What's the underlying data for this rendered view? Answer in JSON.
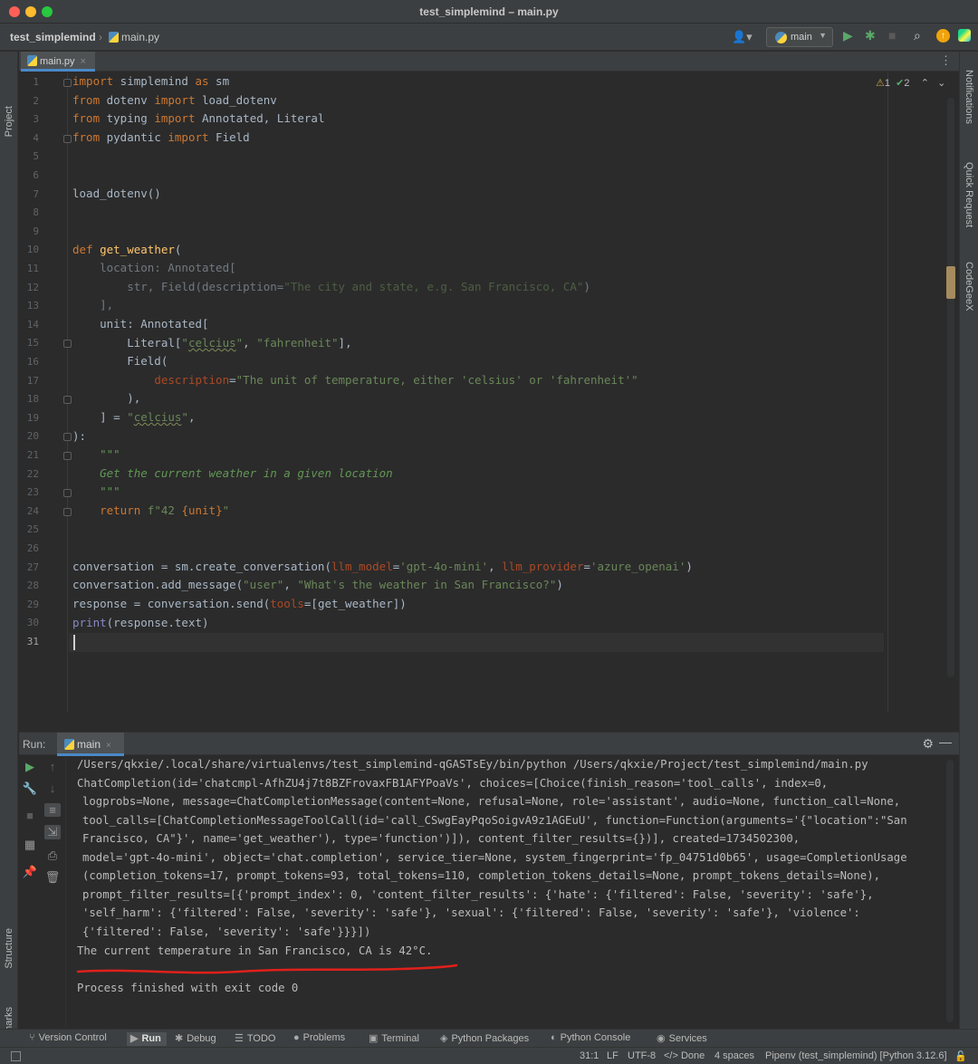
{
  "window": {
    "title": "test_simplemind – main.py"
  },
  "nav": {
    "project": "test_simplemind",
    "file": "main.py",
    "run_config": "main"
  },
  "left_tools": {
    "project": "Project",
    "structure": "Structure",
    "bookmarks": "Bookmarks"
  },
  "right_tools": {
    "notifications": "Notifications",
    "quick_request": "Quick Request",
    "codegeex": "CodeGeeX"
  },
  "editor": {
    "tab": "main.py",
    "inspections": {
      "warnings": "1",
      "weak_warnings": "2"
    },
    "cursor_line": 31,
    "line_numbers": [
      "1",
      "2",
      "3",
      "4",
      "5",
      "6",
      "7",
      "8",
      "9",
      "10",
      "11",
      "12",
      "13",
      "14",
      "15",
      "16",
      "17",
      "18",
      "19",
      "20",
      "21",
      "22",
      "23",
      "24",
      "25",
      "26",
      "27",
      "28",
      "29",
      "30",
      "31"
    ],
    "code": {
      "l1": [
        "import",
        " simplemind ",
        "as",
        " sm"
      ],
      "l2": [
        "from",
        " dotenv ",
        "import",
        " load_dotenv"
      ],
      "l3": [
        "from",
        " typing ",
        "import",
        " Annotated, Literal"
      ],
      "l4": [
        "from",
        " pydantic ",
        "import",
        " Field"
      ],
      "l7": "load_dotenv()",
      "l10": [
        "def",
        " ",
        "get_weather",
        "("
      ],
      "l11": "    location: Annotated[",
      "l12": [
        "        str, Field(description=",
        "\"The city and state, e.g. San Francisco, CA\"",
        ")"
      ],
      "l13": "    ],",
      "l14": "    unit: Annotated[",
      "l15": [
        "        Literal[",
        "\"",
        "celcius",
        "\"",
        ", ",
        "\"fahrenheit\"",
        "],"
      ],
      "l16": "        Field(",
      "l17": [
        "            ",
        "description",
        "=",
        "\"The unit of temperature, either 'celsius' or 'fahrenheit'\""
      ],
      "l18": "        ),",
      "l19": [
        "    ] = ",
        "\"",
        "celcius",
        "\"",
        ","
      ],
      "l20": "):",
      "l21": "    \"\"\"",
      "l22": "    Get the current weather in a given location",
      "l23": "    \"\"\"",
      "l24": [
        "    ",
        "return",
        " ",
        "f\"42 ",
        "{unit}",
        "\""
      ],
      "l27": [
        "conversation = sm.create_conversation(",
        "llm_model",
        "=",
        "'gpt-4o-mini'",
        ", ",
        "llm_provider",
        "=",
        "'azure_openai'",
        ")"
      ],
      "l28": [
        "conversation.add_message(",
        "\"user\"",
        ", ",
        "\"What's the weather in San Francisco?\"",
        ")"
      ],
      "l29": [
        "response = conversation.send(",
        "tools",
        "=[get_weather])"
      ],
      "l30": [
        "print",
        "(response.text)"
      ]
    }
  },
  "run": {
    "label": "Run:",
    "tab": "main",
    "lines": [
      "/Users/qkxie/.local/share/virtualenvs/test_simplemind-qGASTsEy/bin/python /Users/qkxie/Project/test_simplemind/main.py",
      "ChatCompletion(id='chatcmpl-AfhZU4j7t8BZFrovaxFB1AFYPoaVs', choices=[Choice(finish_reason='tool_calls', index=0,",
      "logprobs=None, message=ChatCompletionMessage(content=None, refusal=None, role='assistant', audio=None, function_call=None,",
      "tool_calls=[ChatCompletionMessageToolCall(id='call_CSwgEayPqoSoigvA9z1AGEuU', function=Function(arguments='{\"location\":\"San",
      "Francisco, CA\"}', name='get_weather'), type='function')]), content_filter_results={})], created=1734502300,",
      "model='gpt-4o-mini', object='chat.completion', service_tier=None, system_fingerprint='fp_04751d0b65', usage=CompletionUsage",
      "(completion_tokens=17, prompt_tokens=93, total_tokens=110, completion_tokens_details=None, prompt_tokens_details=None),",
      "prompt_filter_results=[{'prompt_index': 0, 'content_filter_results': {'hate': {'filtered': False, 'severity': 'safe'},",
      "'self_harm': {'filtered': False, 'severity': 'safe'}, 'sexual': {'filtered': False, 'severity': 'safe'}, 'violence':",
      "{'filtered': False, 'severity': 'safe'}}}])",
      "The current temperature in San Francisco, CA is 42°C.",
      "",
      "Process finished with exit code 0"
    ],
    "annotation_color": "#e0201b"
  },
  "bottom_tools": [
    "Version Control",
    "Run",
    "Debug",
    "TODO",
    "Problems",
    "Terminal",
    "Python Packages",
    "Python Console",
    "Services"
  ],
  "status": {
    "position": "31:1",
    "line_sep": "LF",
    "encoding": "UTF-8",
    "done": "Done",
    "indent": "4 spaces",
    "interpreter": "Pipenv (test_simplemind) [Python 3.12.6]"
  }
}
